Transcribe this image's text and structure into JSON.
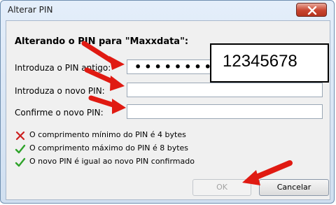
{
  "window": {
    "title": "Alterar PIN"
  },
  "heading": "Alterando o PIN para \"Maxxdata\":",
  "fields": {
    "old_pin_label": "Introduza o PIN antigo:",
    "old_pin_value": "••••••••",
    "new_pin_label": "Introduza o novo PIN:",
    "confirm_pin_label": "Confirme o novo PIN:"
  },
  "overlay": {
    "text": "12345678"
  },
  "rules": [
    {
      "text": "O comprimento mínimo do PIN é 4 bytes",
      "status": "fail",
      "icon": "x-icon"
    },
    {
      "text": "O comprimento máximo do PIN é 8 bytes",
      "status": "ok",
      "icon": "check-icon"
    },
    {
      "text": "O novo PIN é igual ao novo PIN confirmado",
      "status": "ok",
      "icon": "check-icon"
    }
  ],
  "buttons": {
    "ok_label": "OK",
    "cancel_label": "Cancelar"
  },
  "colors": {
    "fail": "#cc1f1f",
    "ok": "#2fa32a",
    "arrow": "#e01a12",
    "close": "#c8442f"
  }
}
